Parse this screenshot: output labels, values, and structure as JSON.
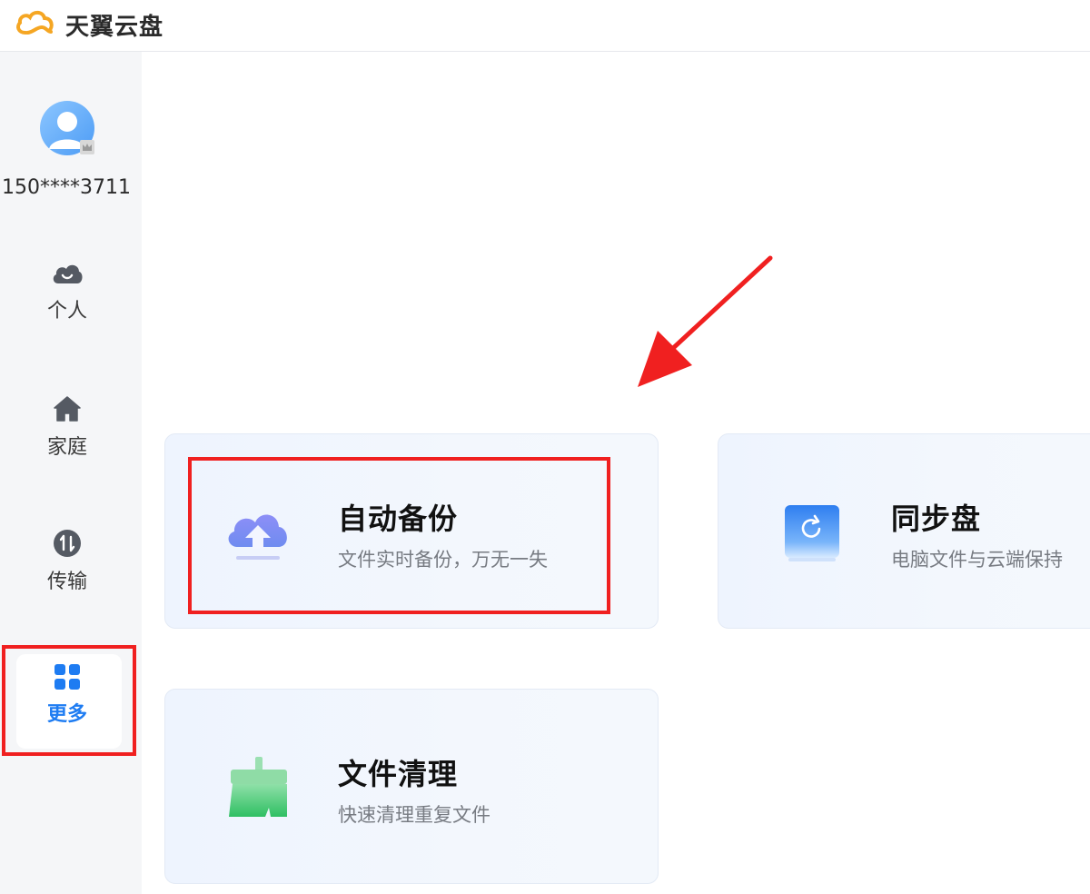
{
  "app": {
    "title": "天翼云盘"
  },
  "user": {
    "phone": "150****3711"
  },
  "sidebar": {
    "items": [
      {
        "label": "个人",
        "icon": "cloud-person-icon"
      },
      {
        "label": "家庭",
        "icon": "home-icon"
      },
      {
        "label": "传输",
        "icon": "transfer-icon"
      },
      {
        "label": "更多",
        "icon": "grid-icon",
        "active": true
      }
    ]
  },
  "cards": [
    {
      "title": "自动备份",
      "desc": "文件实时备份，万无一失",
      "icon": "cloud-upload-icon"
    },
    {
      "title": "同步盘",
      "desc": "电脑文件与云端保持",
      "icon": "sync-icon"
    },
    {
      "title": "文件清理",
      "desc": "快速清理重复文件",
      "icon": "broom-icon"
    }
  ],
  "colors": {
    "accent": "#1e7cf2",
    "annotation": "#f02020",
    "sidebar_bg": "#f5f6f8"
  }
}
